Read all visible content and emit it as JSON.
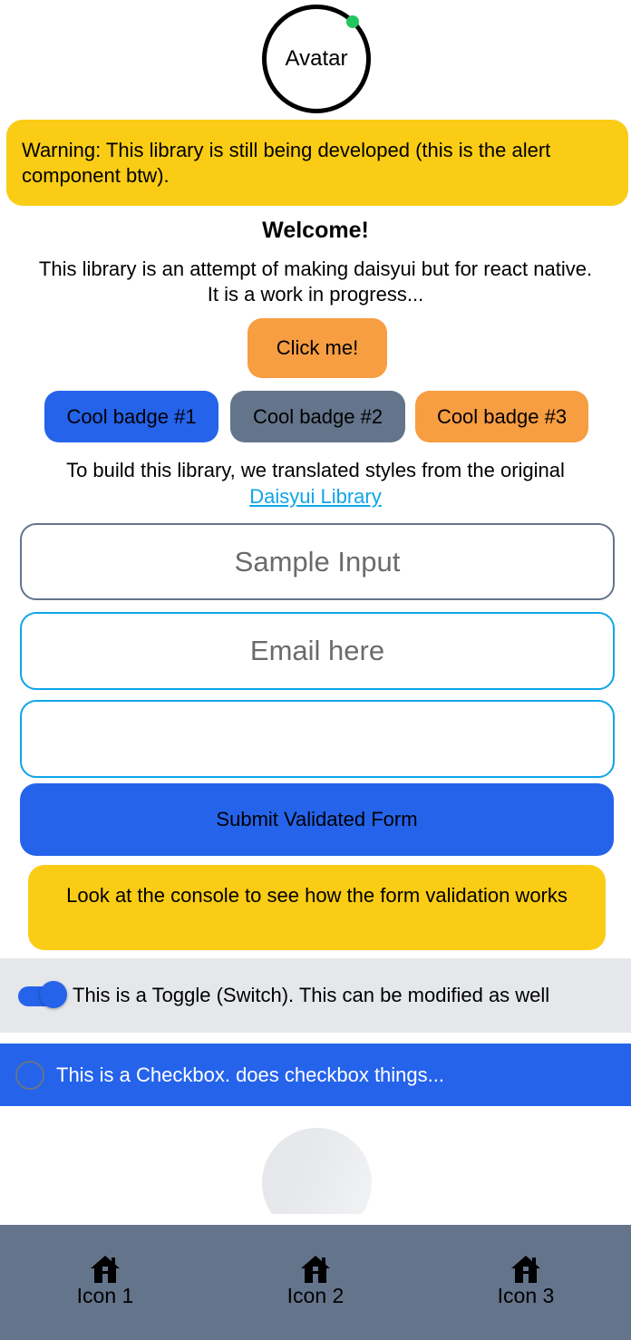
{
  "avatar": {
    "label": "Avatar",
    "status_color": "#22c55e"
  },
  "alert": {
    "text": "Warning: This library is still being developed (this is the alert component btw)."
  },
  "welcome": {
    "title": "Welcome!",
    "text": "This library is an attempt of making daisyui but for react native. It is a work in progress..."
  },
  "click_button": {
    "label": "Click me!"
  },
  "badges": [
    {
      "label": "Cool badge #1",
      "color": "#2563eb"
    },
    {
      "label": "Cool badge #2",
      "color": "#64748b"
    },
    {
      "label": "Cool badge #3",
      "color": "#f79d42"
    }
  ],
  "build": {
    "text": "To build this library, we translated styles from the original",
    "link_label": "Daisyui Library"
  },
  "form": {
    "sample_input": {
      "placeholder": "Sample Input",
      "value": ""
    },
    "email_input": {
      "placeholder": "Email here",
      "value": ""
    },
    "third_input": {
      "placeholder": "",
      "value": ""
    },
    "submit_label": "Submit Validated Form"
  },
  "console_note": {
    "text": "Look at the console to see how the form validation works"
  },
  "toggle": {
    "label": "This is a Toggle (Switch). This can be modified as well",
    "on": true
  },
  "checkbox": {
    "label": "This is a Checkbox. does checkbox things...",
    "checked": false
  },
  "bottom_nav": {
    "items": [
      {
        "icon": "home-icon",
        "label": "Icon 1"
      },
      {
        "icon": "home-icon",
        "label": "Icon 2"
      },
      {
        "icon": "home-icon",
        "label": "Icon 3"
      }
    ]
  },
  "colors": {
    "primary": "#2563eb",
    "warning": "#facc15",
    "accent": "#f79d42",
    "neutral": "#64748b",
    "info": "#0ea5e9"
  }
}
